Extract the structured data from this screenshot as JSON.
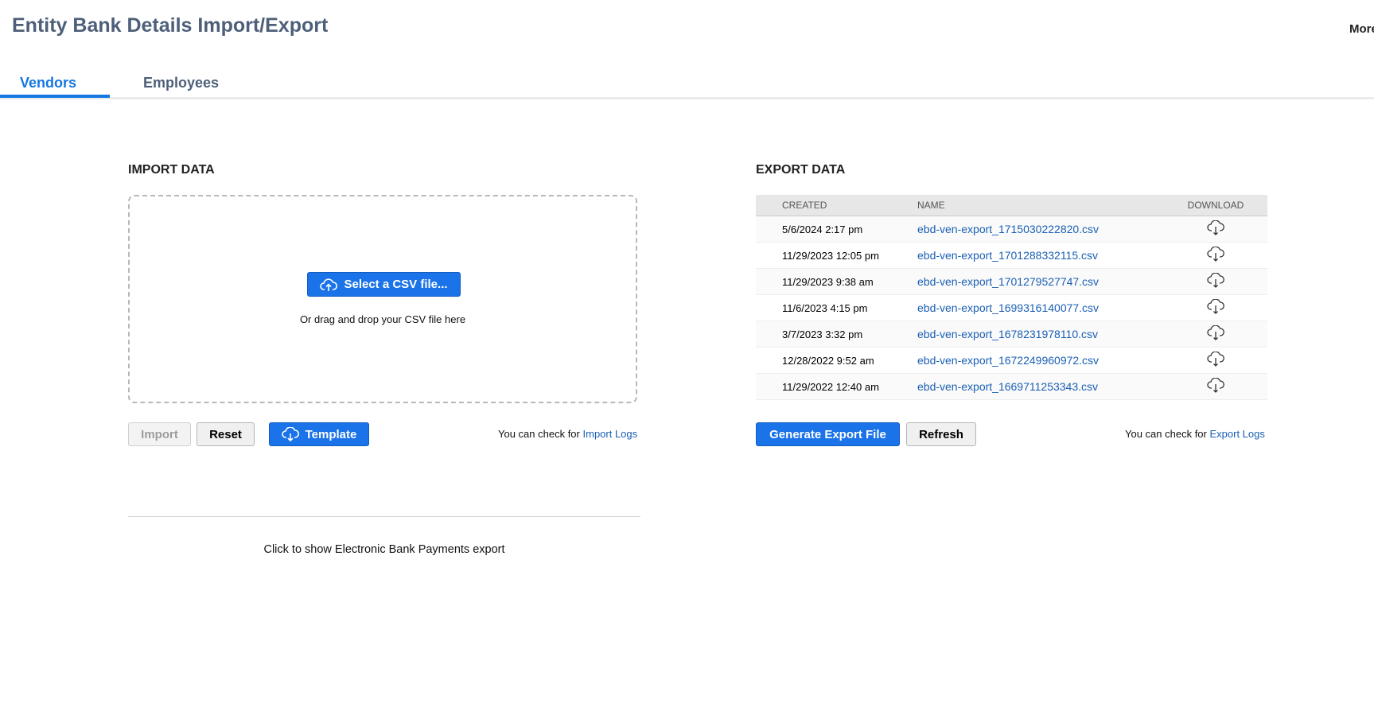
{
  "header": {
    "title": "Entity Bank Details Import/Export",
    "more_label": "More"
  },
  "tabs": [
    {
      "label": "Vendors",
      "active": true
    },
    {
      "label": "Employees",
      "active": false
    }
  ],
  "import": {
    "section_title": "IMPORT DATA",
    "select_button_label": "Select a CSV file...",
    "drag_text": "Or drag and drop your CSV file here",
    "import_button_label": "Import",
    "reset_button_label": "Reset",
    "template_button_label": "Template",
    "check_prefix": "You can check for",
    "logs_link_label": "Import Logs",
    "ebp_toggle_label": "Click to show Electronic Bank Payments export"
  },
  "export": {
    "section_title": "EXPORT DATA",
    "columns": [
      "CREATED",
      "NAME",
      "DOWNLOAD"
    ],
    "rows": [
      {
        "created": "5/6/2024 2:17 pm",
        "name": "ebd-ven-export_1715030222820.csv"
      },
      {
        "created": "11/29/2023 12:05 pm",
        "name": "ebd-ven-export_1701288332115.csv"
      },
      {
        "created": "11/29/2023 9:38 am",
        "name": "ebd-ven-export_1701279527747.csv"
      },
      {
        "created": "11/6/2023 4:15 pm",
        "name": "ebd-ven-export_1699316140077.csv"
      },
      {
        "created": "3/7/2023 3:32 pm",
        "name": "ebd-ven-export_1678231978110.csv"
      },
      {
        "created": "12/28/2022 9:52 am",
        "name": "ebd-ven-export_1672249960972.csv"
      },
      {
        "created": "11/29/2022 12:40 am",
        "name": "ebd-ven-export_1669711253343.csv"
      }
    ],
    "generate_button_label": "Generate Export File",
    "refresh_button_label": "Refresh",
    "check_prefix": "You can check for",
    "logs_link_label": "Export Logs"
  },
  "colors": {
    "accent": "#1a73e8",
    "title": "#4d5f79",
    "link": "#1a5fb4"
  },
  "icons": {
    "upload": "cloud-upload-icon",
    "download": "cloud-download-icon"
  }
}
